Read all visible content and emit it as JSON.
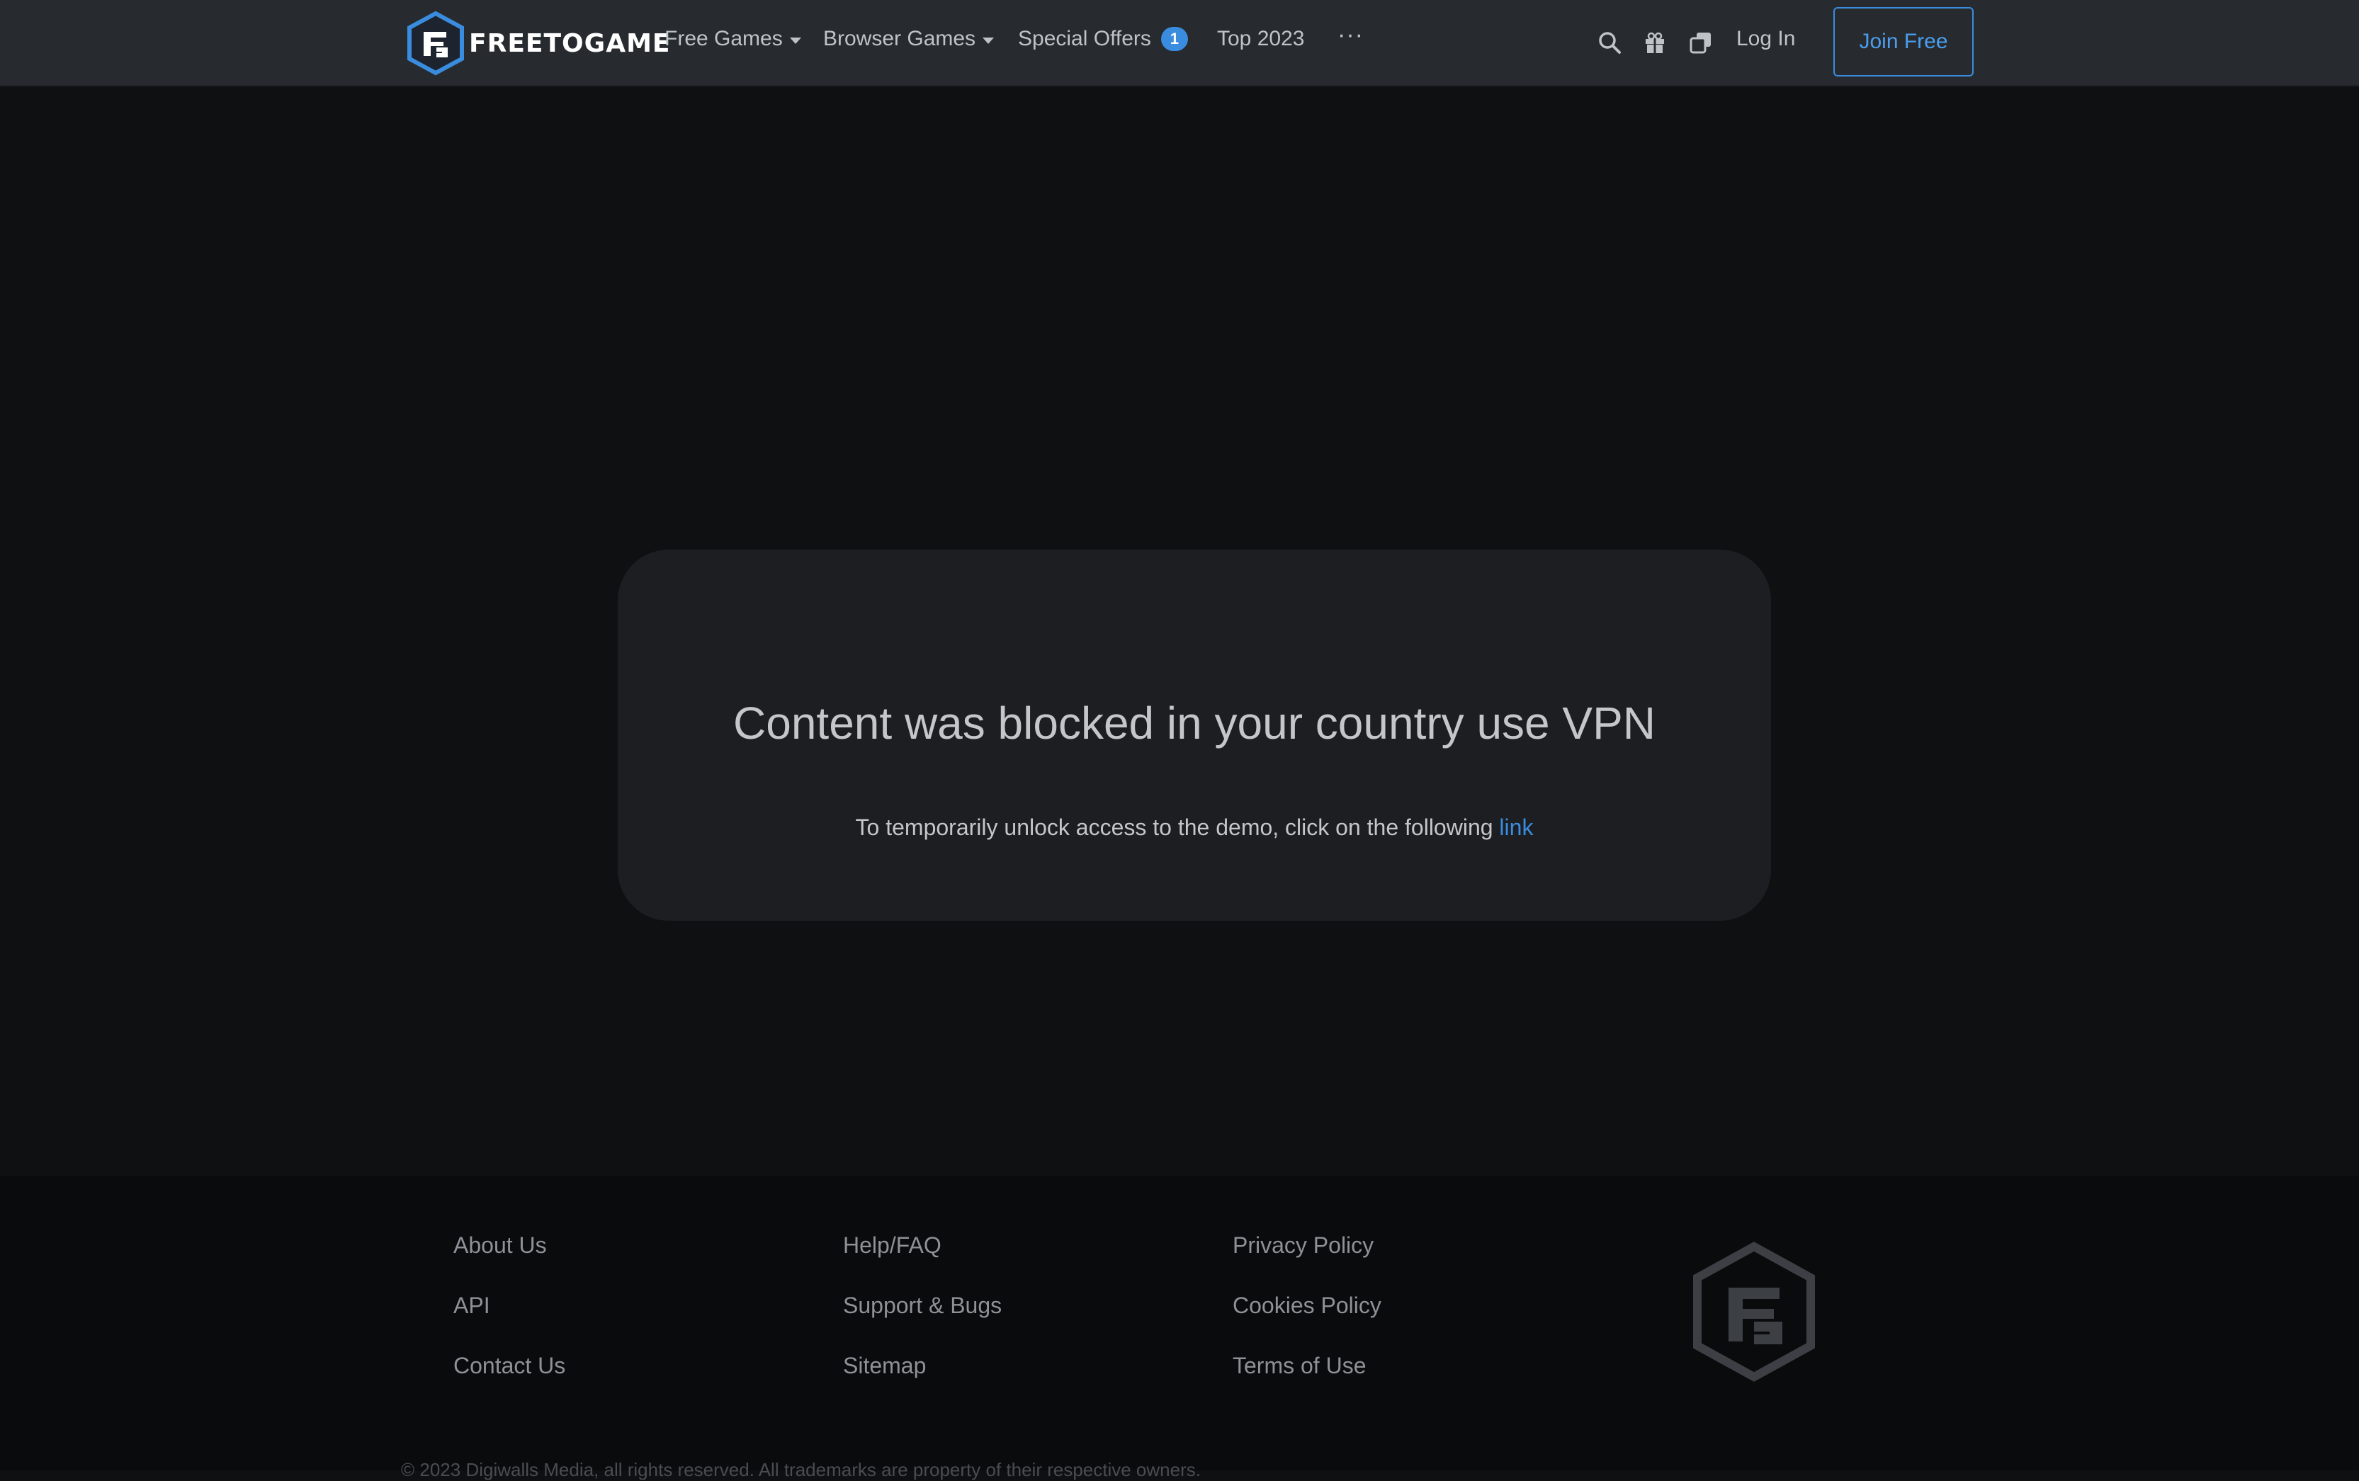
{
  "brand": {
    "name": "FREETOGAME"
  },
  "nav": {
    "free_games": "Free Games",
    "browser_games": "Browser Games",
    "special_offers": "Special Offers",
    "special_offers_badge": "1",
    "top": "Top 2023",
    "more": "···",
    "login": "Log In",
    "join": "Join Free"
  },
  "icons": [
    "search-icon",
    "gift-icon",
    "copy-icon",
    "more-icon",
    "logo-icon"
  ],
  "colors": {
    "accent": "#3a8dde",
    "navbar_bg": "#272b30",
    "page_bg": "#0f1012",
    "card_bg": "#1d1e21"
  },
  "message": {
    "title": "Content was blocked in your country use VPN",
    "text": "To temporarily unlock access to the demo, click on the following",
    "link": "link"
  },
  "footer": {
    "col1": [
      "About Us",
      "API",
      "Contact Us"
    ],
    "col2": [
      "Help/FAQ",
      "Support & Bugs",
      "Sitemap"
    ],
    "col3": [
      "Privacy Policy",
      "Cookies Policy",
      "Terms of Use"
    ],
    "copyright": "© 2023 Digiwalls Media, all rights reserved. All trademarks are property of their respective owners."
  }
}
